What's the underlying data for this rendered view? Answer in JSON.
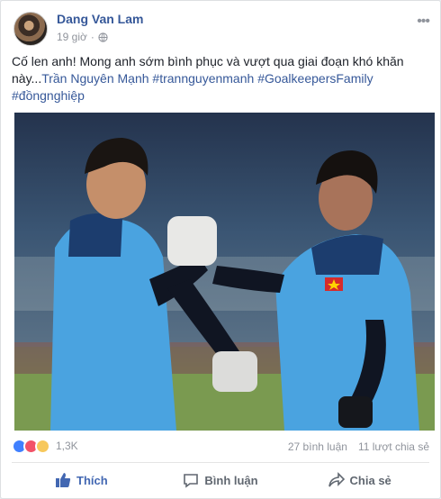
{
  "post": {
    "author": "Dang Van Lam",
    "time": "19 giờ",
    "caption_lines": {
      "text": "Cố len anh! Mong anh sớm bình phục và vượt qua giai đoạn khó khăn này...",
      "mention": "Trần Nguyên Mạnh",
      "hashtags": [
        "#trannguyenmanh",
        "#GoalkeepersFamily",
        "#đồngnghiệp"
      ]
    },
    "reaction_count": "1,3K",
    "comments": "27 bình luận",
    "shares": "11 lượt chia sẻ"
  },
  "actions": {
    "like": "Thích",
    "comment": "Bình luận",
    "share": "Chia sẻ"
  },
  "colors": {
    "link": "#365899",
    "like_active": "#4267b2",
    "jersey": "#4aa3e0"
  },
  "icons": [
    "globe-icon",
    "more-icon",
    "like-icon",
    "comment-icon",
    "share-icon"
  ]
}
